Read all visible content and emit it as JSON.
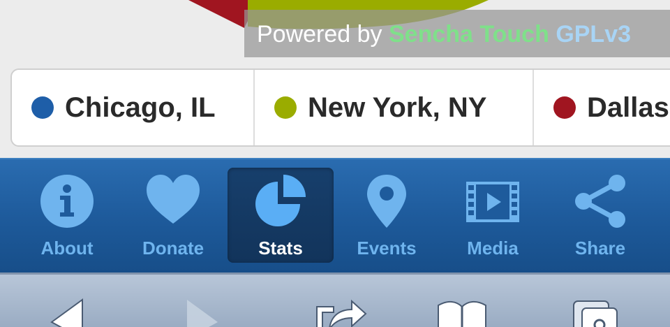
{
  "powered_by": {
    "prefix": "Powered by",
    "brand": "Sencha Touch",
    "license": "GPLv3"
  },
  "legend": [
    {
      "label": "Chicago, IL",
      "color": "#1e5ea8"
    },
    {
      "label": "New York, NY",
      "color": "#9aac00"
    },
    {
      "label": "Dallas",
      "color": "#a01520"
    }
  ],
  "tabs": [
    {
      "label": "About",
      "icon": "info-icon",
      "active": false
    },
    {
      "label": "Donate",
      "icon": "heart-icon",
      "active": false
    },
    {
      "label": "Stats",
      "icon": "pie-chart-icon",
      "active": true
    },
    {
      "label": "Events",
      "icon": "map-pin-icon",
      "active": false
    },
    {
      "label": "Media",
      "icon": "film-play-icon",
      "active": false
    },
    {
      "label": "Share",
      "icon": "share-icon",
      "active": false
    }
  ],
  "browser_toolbar": {
    "buttons": [
      "back-icon",
      "forward-icon",
      "action-icon",
      "bookmarks-icon",
      "pages-icon"
    ]
  },
  "colors": {
    "tab_icon": "#6fb4ee",
    "tab_icon_active": "#5aaef5",
    "tabbar_bg": "#1e5b9c"
  }
}
